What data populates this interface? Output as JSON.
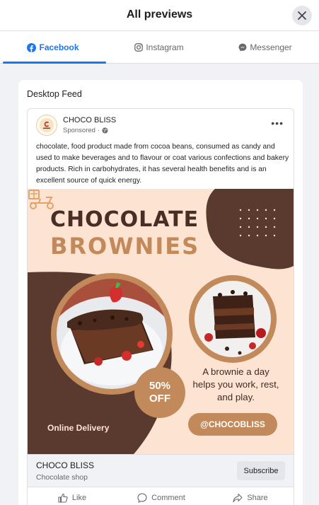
{
  "header": {
    "title": "All previews",
    "close_icon": "close-icon"
  },
  "tabs": [
    {
      "label": "Facebook",
      "icon": "facebook-icon",
      "active": true
    },
    {
      "label": "Instagram",
      "icon": "instagram-icon",
      "active": false
    },
    {
      "label": "Messenger",
      "icon": "messenger-icon",
      "active": false
    }
  ],
  "panel": {
    "title": "Desktop Feed"
  },
  "post": {
    "page_name": "CHOCO BLISS",
    "sponsored": "Sponsored ·",
    "caption": "chocolate, food product made from cocoa beans, consumed as candy and used to make beverages and to flavour or coat various confections and bakery products. Rich in carbohydrates, it has several health benefits and is an excellent source of quick energy.",
    "creative": {
      "headline_1": "CHOCOLATE",
      "headline_2": "BROWNIES",
      "offer_1": "50%",
      "offer_2": "OFF",
      "delivery": "Online Delivery",
      "tagline": "A brownie a day helps you work, rest, and play.",
      "handle": "@CHOCOBLISS"
    },
    "cta": {
      "name": "CHOCO BLISS",
      "subtitle": "Chocolate shop",
      "button": "Subscribe"
    },
    "actions": {
      "like": "Like",
      "comment": "Comment",
      "share": "Share"
    }
  },
  "colors": {
    "accent": "#1877f2",
    "brown_dark": "#5a3a2f",
    "caramel": "#c2895a",
    "cream": "#fde4d2"
  }
}
